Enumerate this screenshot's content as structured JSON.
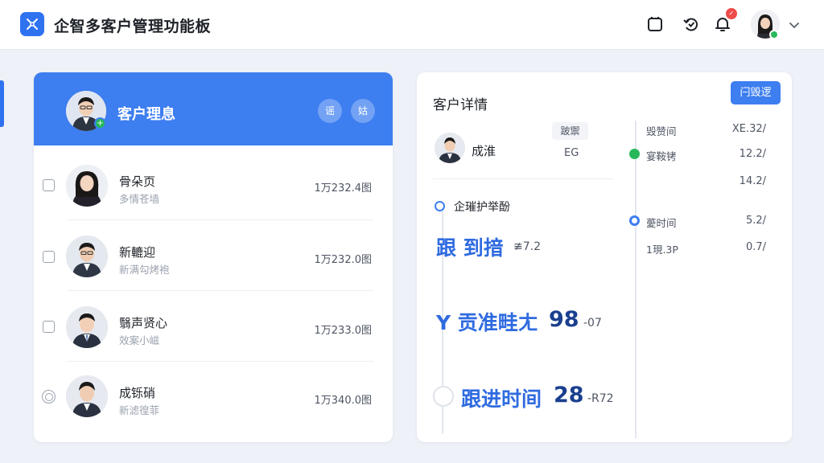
{
  "app": {
    "title": "企智多客户管理功能板"
  },
  "colors": {
    "accent": "#3d7ef0",
    "success": "#27b85b",
    "danger": "#f04b4b"
  },
  "topbar": {
    "icons": [
      "square-icon",
      "refresh-check-icon",
      "bell-icon",
      "user-avatar",
      "chevron-down-icon"
    ],
    "notification_badge": "✓"
  },
  "left_panel": {
    "header_title": "客户理息",
    "header_buttons": [
      "谣",
      "姑"
    ],
    "rows": [
      {
        "name": "骨朵页",
        "sub": "多情苍墙",
        "amount": "1万232.4图",
        "control": "checkbox"
      },
      {
        "name": "新轆迎",
        "sub": "新满勾烤袍",
        "amount": "1万232.0图",
        "control": "checkbox"
      },
      {
        "name": "翳声贤心",
        "sub": "效案小嵫",
        "amount": "1万233.0图",
        "control": "checkbox"
      },
      {
        "name": "成铄硝",
        "sub": "新滤徨菲",
        "amount": "1万340.0图",
        "control": "radio"
      }
    ]
  },
  "right_panel": {
    "title": "客户详情",
    "button_label": "闩毁逻",
    "contact": {
      "name": "成淮",
      "tag": "跛禦",
      "code": "EG"
    },
    "section_title": "企璀护举酚",
    "followups": [
      {
        "label": "跟 到揞",
        "value": "",
        "suffix": "≇7.2"
      },
      {
        "label": "Y 贡准畦ㄤ",
        "value": "98",
        "suffix": "-07"
      },
      {
        "label": "跟进时间",
        "value": "28",
        "suffix": "-R72"
      }
    ],
    "timeline": [
      {
        "label": "毁赞间",
        "value": "XE.32/",
        "dot": ""
      },
      {
        "label": "宴鞍铐",
        "value": "12.2/",
        "dot": "green"
      },
      {
        "label": "",
        "value": "14.2/",
        "dot": ""
      },
      {
        "label": "薆时间",
        "value": "5.2/",
        "dot": "blue"
      },
      {
        "label": "1現.3P",
        "value": "0.7/",
        "dot": ""
      }
    ]
  }
}
